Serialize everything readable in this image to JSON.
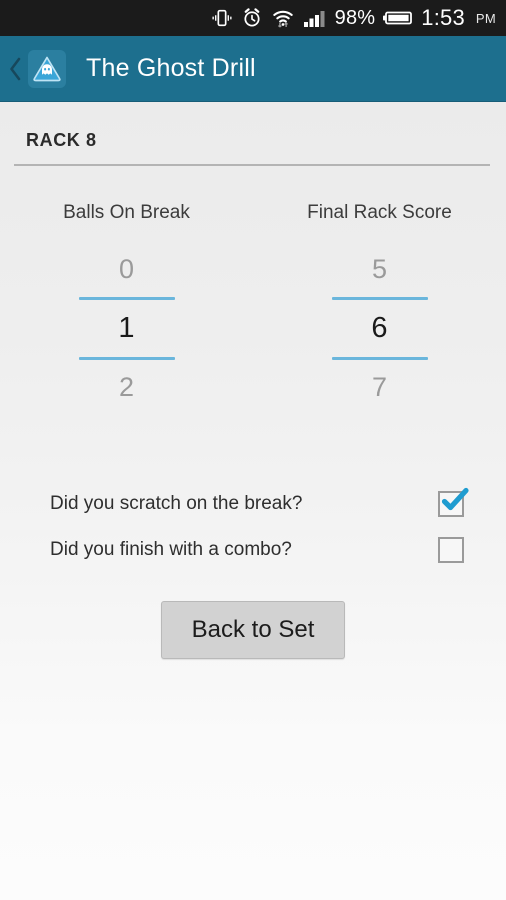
{
  "statusbar": {
    "icons": [
      "vibrate-icon",
      "alarm-clock-icon",
      "wifi-icon",
      "signal-bars-icon",
      "battery-icon"
    ],
    "battery_percent": "98%",
    "time": "1:53",
    "ampm": "PM"
  },
  "appbar": {
    "back_label": "‹",
    "app_icon": "ghost-triangle-app-icon",
    "title": "The Ghost Drill",
    "color": "#1d6f8e"
  },
  "section": {
    "rack_title": "RACK 8"
  },
  "pickers": [
    {
      "name": "balls-on-break",
      "label": "Balls On Break",
      "previous": "0",
      "selected": "1",
      "next": "2"
    },
    {
      "name": "final-rack-score",
      "label": "Final Rack Score",
      "previous": "5",
      "selected": "6",
      "next": "7"
    }
  ],
  "checkboxes": [
    {
      "name": "scratch-on-break",
      "label": "Did you scratch on the break?",
      "checked": true
    },
    {
      "name": "finish-with-combo",
      "label": "Did you finish with a combo?",
      "checked": false
    }
  ],
  "button": {
    "label": "Back to Set"
  },
  "colors": {
    "appbar": "#1d6f8e",
    "picker_divider": "#6ab6dc",
    "check_accent": "#1f9cd0",
    "background_top": "#ebebeb",
    "background_bottom": "#fcfcfc"
  }
}
